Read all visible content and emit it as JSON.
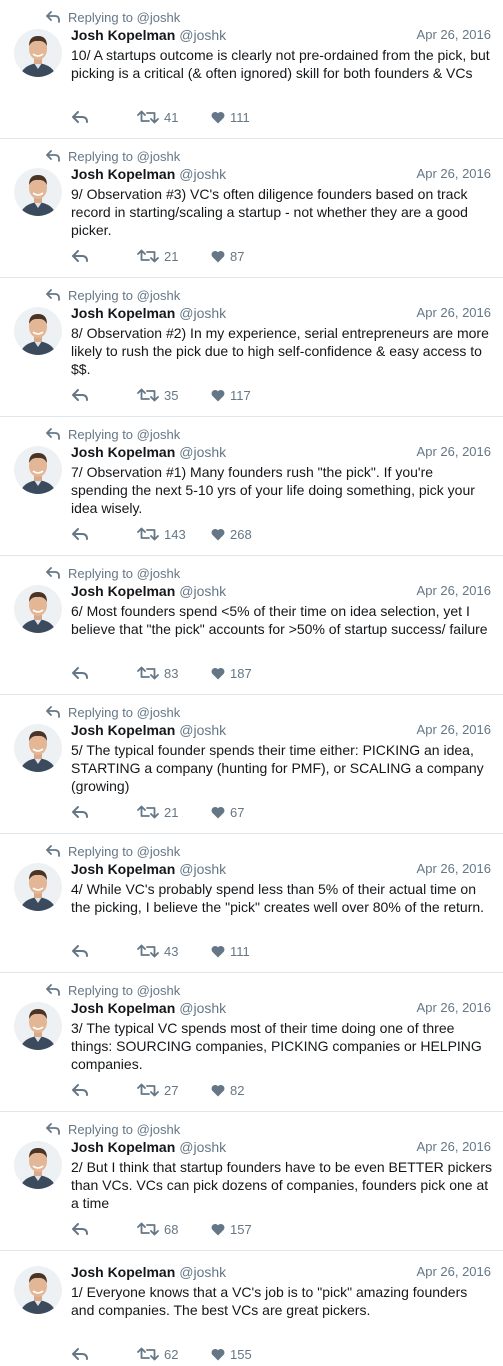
{
  "reply_prefix": "Replying to",
  "author": {
    "name": "Josh Kopelman",
    "handle": "@joshk"
  },
  "colors": {
    "text": "#14171a",
    "muted": "#657786",
    "divider": "#e1e8ed"
  },
  "tweets": [
    {
      "replying_to": "@joshk",
      "date": "Apr 26, 2016",
      "text": "10/ A startups outcome is clearly not pre-ordained from the pick, but picking is a critical (& often ignored) skill for both founders & VCs",
      "retweets": "41",
      "likes": "111"
    },
    {
      "replying_to": "@joshk",
      "date": "Apr 26, 2016",
      "text": "9/ Observation #3) VC's often diligence founders based on track record in starting/scaling a startup - not whether they are a good picker.",
      "retweets": "21",
      "likes": "87"
    },
    {
      "replying_to": "@joshk",
      "date": "Apr 26, 2016",
      "text": "8/ Observation #2) In my experience, serial entrepreneurs are more likely to rush the pick due to high self-confidence & easy access to $$.",
      "retweets": "35",
      "likes": "117"
    },
    {
      "replying_to": "@joshk",
      "date": "Apr 26, 2016",
      "text": "7/ Observation #1) Many founders rush \"the pick\". If you're spending the next 5-10 yrs of your life doing something, pick your idea wisely.",
      "retweets": "143",
      "likes": "268"
    },
    {
      "replying_to": "@joshk",
      "date": "Apr 26, 2016",
      "text": "6/ Most founders spend <5% of their time on idea selection, yet I believe that \"the pick\" accounts for >50% of startup success/ failure",
      "retweets": "83",
      "likes": "187"
    },
    {
      "replying_to": "@joshk",
      "date": "Apr 26, 2016",
      "text": "5/ The typical founder spends their time either: PICKING an idea, STARTING a company (hunting for PMF), or SCALING a company (growing)",
      "retweets": "21",
      "likes": "67"
    },
    {
      "replying_to": "@joshk",
      "date": "Apr 26, 2016",
      "text": "4/ While VC's probably spend less than 5% of their actual time on the picking, I believe the \"pick\" creates well over 80% of the return.",
      "retweets": "43",
      "likes": "111"
    },
    {
      "replying_to": "@joshk",
      "date": "Apr 26, 2016",
      "text": "3/ The typical VC spends most of their time doing one of three things: SOURCING companies, PICKING companies or HELPING companies.",
      "retweets": "27",
      "likes": "82"
    },
    {
      "replying_to": "@joshk",
      "date": "Apr 26, 2016",
      "text": "2/  But I think that startup founders have to be even BETTER pickers than VCs. VCs can pick dozens of companies, founders pick one at a time",
      "retweets": "68",
      "likes": "157"
    },
    {
      "replying_to": "",
      "date": "Apr 26, 2016",
      "text": "1/ Everyone knows that a VC's job is to \"pick\" amazing founders and companies.  The best VCs are great pickers.",
      "retweets": "62",
      "likes": "155"
    }
  ]
}
